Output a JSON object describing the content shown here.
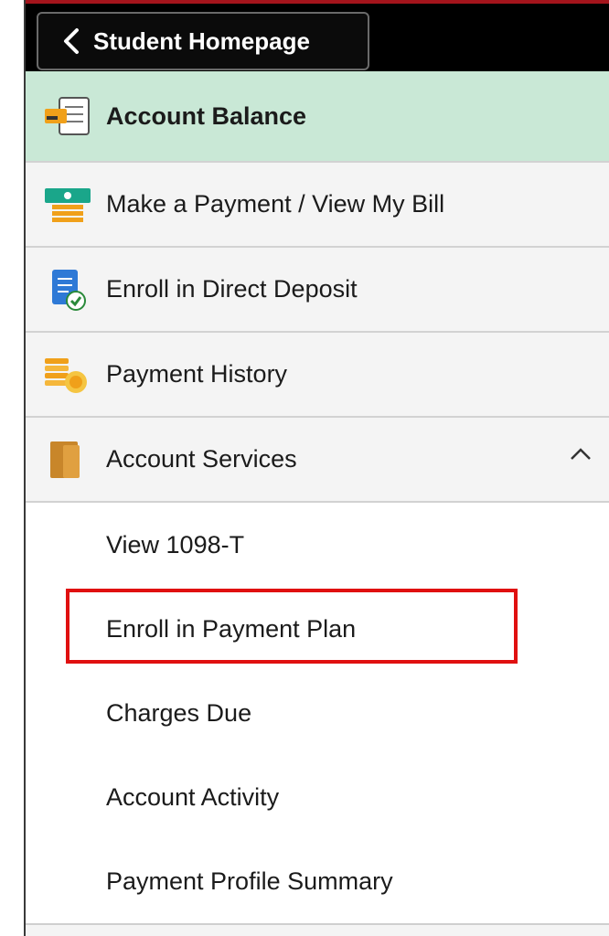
{
  "header": {
    "back_label": "Student Homepage"
  },
  "nav": {
    "items": [
      {
        "label": "Account Balance",
        "icon": "account-balance-icon"
      },
      {
        "label": "Make a Payment / View My Bill",
        "icon": "payment-bill-icon"
      },
      {
        "label": "Enroll in Direct Deposit",
        "icon": "direct-deposit-icon"
      },
      {
        "label": "Payment History",
        "icon": "payment-history-icon"
      },
      {
        "label": "Account Services",
        "icon": "account-services-icon"
      }
    ],
    "sub_items": [
      {
        "label": "View 1098-T"
      },
      {
        "label": "Enroll in Payment Plan"
      },
      {
        "label": "Charges Due"
      },
      {
        "label": "Account Activity"
      },
      {
        "label": "Payment Profile Summary"
      }
    ]
  },
  "colors": {
    "active_background": "#c9e8d6",
    "highlight_border": "#e01010",
    "topbar": "#000000"
  }
}
